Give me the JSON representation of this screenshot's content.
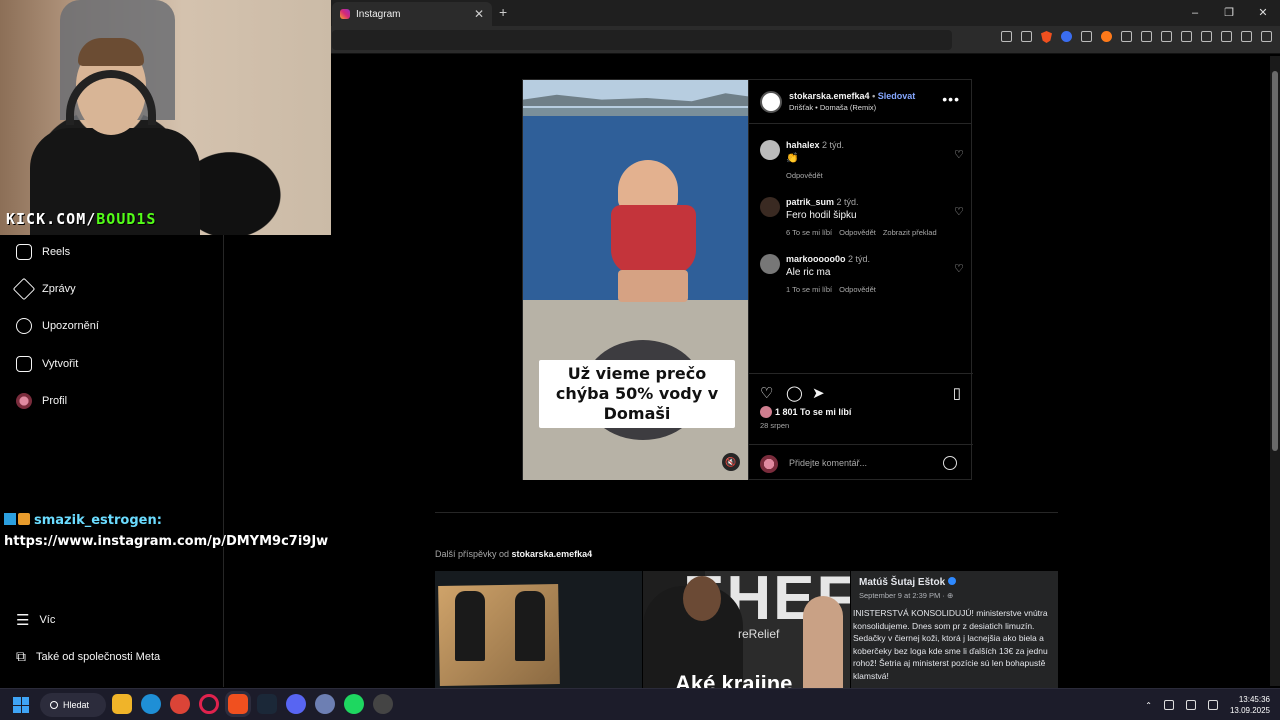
{
  "browser": {
    "tab_title": "Instagram",
    "tab_close": "✕",
    "new_tab": "+",
    "win_min": "–",
    "win_max": "❐",
    "win_close": "✕"
  },
  "webcam": {
    "overlay_text_prefix": "KICK.COM/",
    "overlay_text_user": "BOUD1S"
  },
  "nav": {
    "items": [
      {
        "label": "Reels",
        "icon": "reels-icon"
      },
      {
        "label": "Zprávy",
        "icon": "messages-icon"
      },
      {
        "label": "Upozornění",
        "icon": "heart-icon"
      },
      {
        "label": "Vytvořit",
        "icon": "create-icon"
      },
      {
        "label": "Profil",
        "icon": "profile-avatar"
      }
    ],
    "more": "Víc",
    "meta": "Také od společnosti Meta"
  },
  "chat": {
    "user": "smazik_estrogen:",
    "message": "https://www.instagram.com/p/DMYM9c7i9Jw"
  },
  "post": {
    "author": "stokarska.emefka4",
    "separator": "•",
    "follow": "Sledovat",
    "audio": "Drišťak • Domaša (Remix)",
    "more": "•••",
    "caption": "Už vieme prečo chýba 50% vody v Domaši",
    "comments": [
      {
        "user": "hahalex",
        "ago": "2 týd.",
        "text": "👏",
        "meta": [
          "Odpovědět"
        ]
      },
      {
        "user": "patrik_sum",
        "ago": "2 týd.",
        "text": "Fero hodil šipku",
        "meta": [
          "6 To se mi líbí",
          "Odpovědět",
          "Zobrazit překlad"
        ]
      },
      {
        "user": "markooooo0o",
        "ago": "2 týd.",
        "text": "Ale ric ma",
        "meta": [
          "1 To se mi líbí",
          "Odpovědět"
        ]
      }
    ],
    "likes": "1 801 To se mi líbí",
    "date": "28 srpen",
    "add_comment_placeholder": "Přidejte komentář..."
  },
  "more_posts": {
    "label": "Další příspěvky od",
    "author": "stokarska.emefka4"
  },
  "grid": {
    "cell2_text": "EHEF",
    "cell2_sub": "reRelief",
    "cell2_bottom": "Aké krajine",
    "fb_name": "Matúš Šutaj Eštok",
    "fb_date": "September 9 at 2:39 PM · ⊕",
    "fb_text": "INISTERSTVÁ KONSOLIDUJÚ! ministerstve vnútra konsolidujeme. Dnes som pr z desiatich limuzín. Sedačky v čiernej koži, ktorá j lacnejšia ako biela a koberčeky bez loga kde sme li ďalších 13€ za jednu rohož! Šetria aj ministerst pozície sú len bohapustě klamstvá!"
  },
  "taskbar": {
    "search": "Hledat",
    "time": "13:45:36",
    "date": "13.09.2025"
  }
}
